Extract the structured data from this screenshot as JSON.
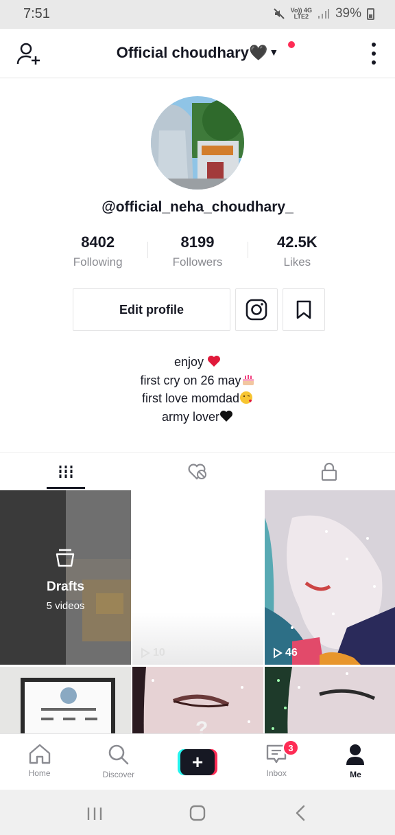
{
  "status_bar": {
    "time": "7:51",
    "network_top": "Vo)) 4G",
    "network_bottom": "LTE2",
    "battery": "39%",
    "icons": [
      "mute-icon",
      "signal-icon",
      "battery-icon"
    ]
  },
  "header": {
    "profile_name": "Official choudhary🖤",
    "icons": [
      "add-user-icon",
      "chevron-down-icon",
      "more-icon"
    ]
  },
  "profile": {
    "handle": "@official_neha_choudhary_",
    "stats": [
      {
        "value": "8402",
        "label": "Following"
      },
      {
        "value": "8199",
        "label": "Followers"
      },
      {
        "value": "42.5K",
        "label": "Likes"
      }
    ],
    "edit_label": "Edit profile",
    "bio": [
      "enjoy",
      "first cry on 26 may",
      "first love momdad",
      "army lover"
    ]
  },
  "tabs": [
    {
      "name": "videos",
      "icon": "grid-icon",
      "active": true
    },
    {
      "name": "liked",
      "icon": "liked-hidden-icon",
      "active": false
    },
    {
      "name": "private",
      "icon": "lock-icon",
      "active": false
    }
  ],
  "grid": {
    "drafts": {
      "title": "Drafts",
      "count": "5 videos"
    },
    "videos": [
      {
        "views": "10"
      },
      {
        "views": "46"
      }
    ]
  },
  "bottom_nav": [
    {
      "label": "Home",
      "icon": "home-icon"
    },
    {
      "label": "Discover",
      "icon": "search-icon"
    },
    {
      "label": "",
      "icon": "create-icon"
    },
    {
      "label": "Inbox",
      "icon": "inbox-icon",
      "badge": "3"
    },
    {
      "label": "Me",
      "icon": "profile-icon",
      "active": true
    }
  ],
  "colors": {
    "accent": "#fe2c55",
    "cyan": "#25f4ee",
    "text": "#161823",
    "muted": "#8a8b91"
  }
}
